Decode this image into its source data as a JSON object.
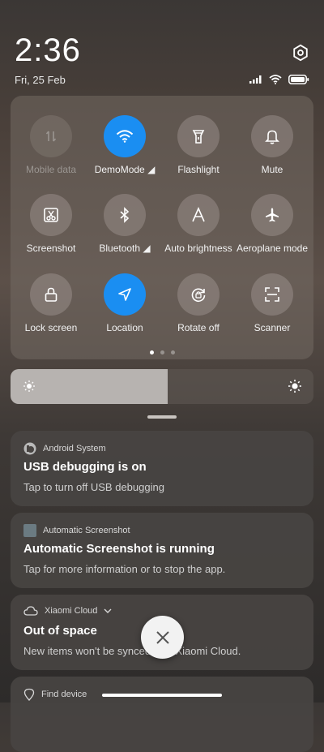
{
  "status": {
    "time": "2:36",
    "date": "Fri, 25 Feb",
    "icons": [
      "settings-icon",
      "signal-icon",
      "wifi-icon",
      "battery-icon"
    ]
  },
  "quick_settings": {
    "tiles": [
      {
        "label": "Mobile data",
        "icon": "mobile-data-icon",
        "state": "disabled"
      },
      {
        "label": "DemoMode ◢",
        "icon": "wifi-icon",
        "state": "on"
      },
      {
        "label": "Flashlight",
        "icon": "flashlight-icon",
        "state": "off"
      },
      {
        "label": "Mute",
        "icon": "bell-icon",
        "state": "off"
      },
      {
        "label": "Screenshot",
        "icon": "screenshot-icon",
        "state": "off"
      },
      {
        "label": "Bluetooth ◢",
        "icon": "bluetooth-icon",
        "state": "off"
      },
      {
        "label": "Auto brightness",
        "icon": "auto-brightness-icon",
        "state": "off"
      },
      {
        "label": "Aeroplane mode",
        "icon": "airplane-icon",
        "state": "off"
      },
      {
        "label": "Lock screen",
        "icon": "lock-icon",
        "state": "off"
      },
      {
        "label": "Location",
        "icon": "location-icon",
        "state": "on"
      },
      {
        "label": "Rotate off",
        "icon": "rotate-icon",
        "state": "off"
      },
      {
        "label": "Scanner",
        "icon": "scanner-icon",
        "state": "off"
      }
    ],
    "active_page": 1,
    "page_count": 3
  },
  "brightness": {
    "level": 0.52
  },
  "notifications": [
    {
      "app": "Android System",
      "title": "USB debugging is on",
      "body": "Tap to turn off USB debugging"
    },
    {
      "app": "Automatic Screenshot",
      "title": "Automatic Screenshot is running",
      "body": "Tap for more information or to stop the app."
    },
    {
      "app": "Xiaomi Cloud",
      "title": "Out of space",
      "body": "New items won't be synced with Xiaomi Cloud."
    },
    {
      "app": "Find device"
    }
  ],
  "colors": {
    "accent": "#1a8ef2"
  }
}
